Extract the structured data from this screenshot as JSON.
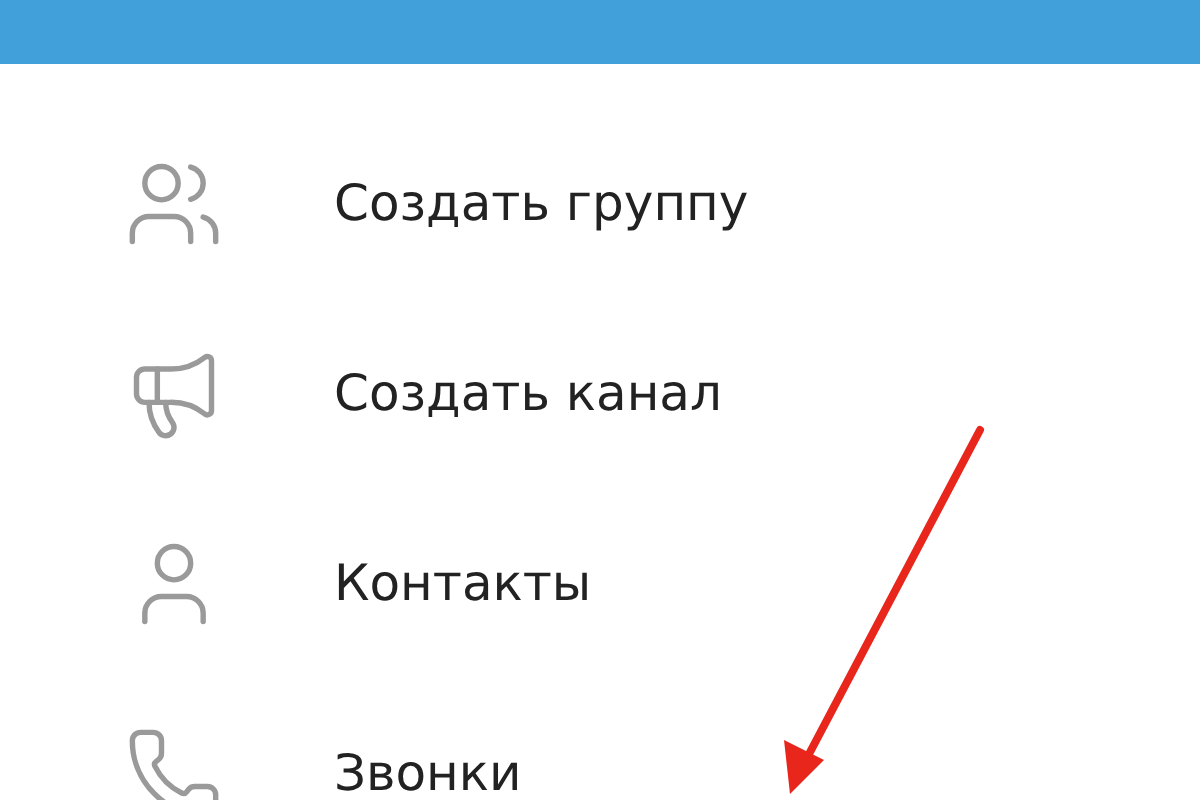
{
  "menu": {
    "items": [
      {
        "label": "Создать группу"
      },
      {
        "label": "Создать канал"
      },
      {
        "label": "Контакты"
      },
      {
        "label": "Звонки"
      }
    ]
  }
}
